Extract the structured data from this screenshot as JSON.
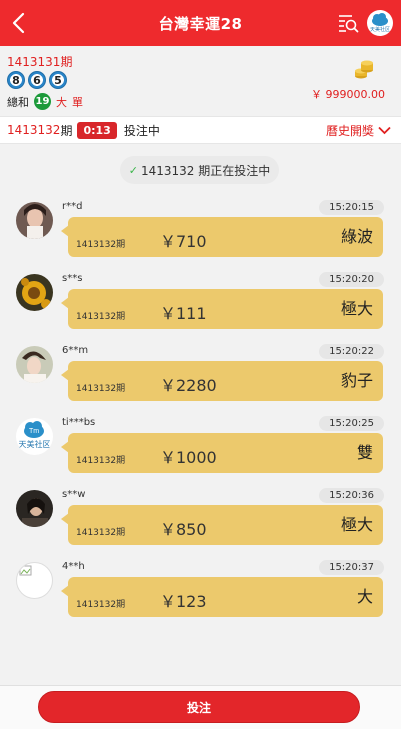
{
  "header": {
    "title": "台灣幸運28",
    "logo_text": "天美社区"
  },
  "last_draw": {
    "period": "1413131期",
    "balls": [
      "8",
      "6",
      "5"
    ],
    "sum_label": "總和",
    "sum_value": "19",
    "tag_big": "大",
    "tag_odd": "單",
    "balance": "￥ 999000.00"
  },
  "current": {
    "period": "1413132",
    "period_suffix": "期",
    "countdown": "0:13",
    "status": "投注中",
    "history_label": "曆史開獎"
  },
  "notice": {
    "text": "1413132 期正在投注中"
  },
  "bets": [
    {
      "user": "r**d",
      "time": "15:20:15",
      "period": "1413132期",
      "amount": "￥710",
      "type": "綠波"
    },
    {
      "user": "s**s",
      "time": "15:20:20",
      "period": "1413132期",
      "amount": "￥111",
      "type": "極大"
    },
    {
      "user": "6**m",
      "time": "15:20:22",
      "period": "1413132期",
      "amount": "￥2280",
      "type": "豹子"
    },
    {
      "user": "ti***bs",
      "time": "15:20:25",
      "period": "1413132期",
      "amount": "￥1000",
      "type": "雙"
    },
    {
      "user": "s**w",
      "time": "15:20:36",
      "period": "1413132期",
      "amount": "￥850",
      "type": "極大"
    },
    {
      "user": "4**h",
      "time": "15:20:37",
      "period": "1413132期",
      "amount": "￥123",
      "type": "大"
    }
  ],
  "avatar_logo_text": "天美社区",
  "footer": {
    "bet_label": "投注"
  },
  "colors": {
    "header": "#ee2a2d",
    "bubble": "#ecc96c",
    "accent": "#e02020",
    "sum_ball": "#1c9a3a"
  }
}
